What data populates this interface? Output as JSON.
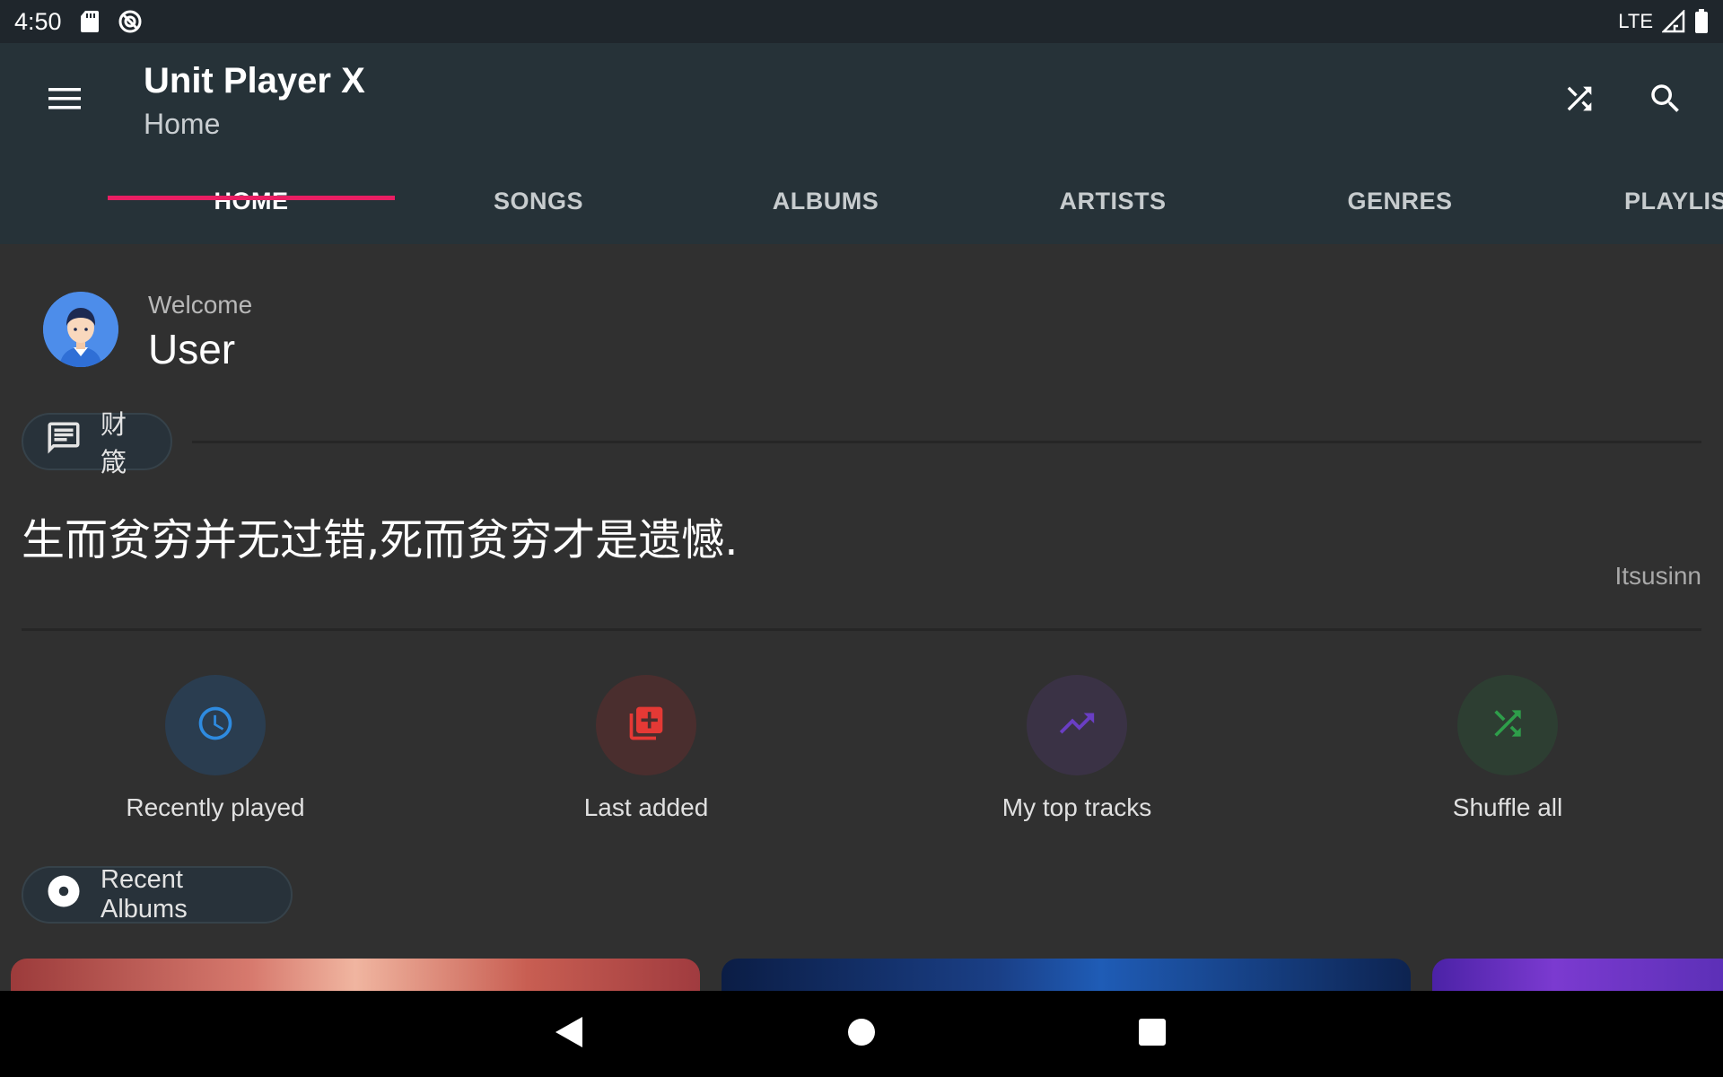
{
  "status_bar": {
    "time": "4:50",
    "network": "LTE",
    "icons": [
      "sd-card-icon",
      "sync-icon",
      "signal-icon",
      "battery-icon"
    ]
  },
  "app_bar": {
    "title": "Unit Player X",
    "subtitle": "Home",
    "icons": [
      "menu-icon",
      "shuffle-icon",
      "search-icon"
    ],
    "background": "#263238"
  },
  "tabs": [
    {
      "label": "HOME",
      "active": true
    },
    {
      "label": "SONGS",
      "active": false
    },
    {
      "label": "ALBUMS",
      "active": false
    },
    {
      "label": "ARTISTS",
      "active": false
    },
    {
      "label": "GENRES",
      "active": false
    },
    {
      "label": "PLAYLISTS",
      "active": false
    }
  ],
  "accent_color": "#e91e63",
  "welcome": {
    "label": "Welcome",
    "user_name": "User"
  },
  "quote_section": {
    "chip_label": "财箴",
    "chip_icon": "message-icon",
    "quote": "生而贫穷并无过错,死而贫穷才是遗憾.",
    "author": "Itsusinn"
  },
  "quick_actions": [
    {
      "label": "Recently played",
      "icon": "clock-icon",
      "color": "#2e8be0",
      "bg": "#2a3d50"
    },
    {
      "label": "Last added",
      "icon": "library-add-icon",
      "color": "#e53935",
      "bg": "#4a2e2e"
    },
    {
      "label": "My top tracks",
      "icon": "trending-up-icon",
      "color": "#6a3ec4",
      "bg": "#3a3245"
    },
    {
      "label": "Shuffle all",
      "icon": "shuffle-icon",
      "color": "#2e9e4a",
      "bg": "#2d3e32"
    }
  ],
  "recent_albums": {
    "chip_label": "Recent Albums",
    "chip_icon": "album-icon"
  },
  "nav_bar": {
    "icons": [
      "back-icon",
      "home-icon",
      "recents-icon"
    ]
  }
}
